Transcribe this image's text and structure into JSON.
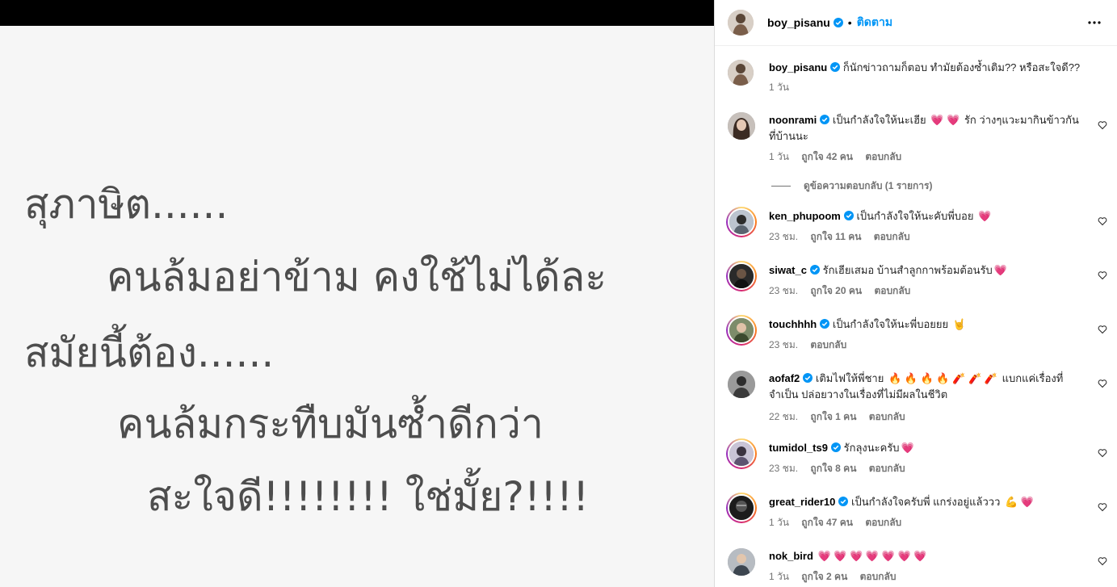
{
  "media": {
    "lines": [
      "สุภาษิต......",
      "คนล้มอย่าข้าม คงใช้ไม่ได้ละ",
      "สมัยนี้ต้อง......",
      "คนล้มกระทืบมันซ้ำดีกว่า",
      "สะใจดี!!!!!!!! ใช่มั้ย?!!!!"
    ]
  },
  "header": {
    "username": "boy_pisanu",
    "dot": "•",
    "follow_label": "ติดตาม"
  },
  "caption": {
    "username": "boy_pisanu",
    "text": "ก็นักข่าวถามก็ตอบ ทำมัยต้องซ้ำเติม?? หรือสะใจดี??",
    "time": "1 วัน"
  },
  "comments": [
    {
      "username": "noonrami",
      "text_a": "เป็นกำลังใจให้นะเฮีย",
      "emoji_a": "💗 💗",
      "text_b": "รัก ว่างๆแวะมากินข้าวกันที่บ้านนะ",
      "time": "1 วัน",
      "likes": "ถูกใจ 42 คน",
      "reply": "ตอบกลับ"
    },
    {
      "username": "ken_phupoom",
      "text_a": "เป็นกำลังใจให้นะคับพี่บอย",
      "emoji_a": "💗",
      "time": "23 ชม.",
      "likes": "ถูกใจ 11 คน",
      "reply": "ตอบกลับ"
    },
    {
      "username": "siwat_c",
      "text_a": "รักเฮียเสมอ บ้านสำลูกกาพร้อมต้อนรับ",
      "emoji_a": "💗",
      "time": "23 ชม.",
      "likes": "ถูกใจ 20 คน",
      "reply": "ตอบกลับ"
    },
    {
      "username": "touchhhh",
      "text_a": "เป็นกำลังใจให้นะพี่บอยยย",
      "emoji_a": "🤘",
      "time": "23 ชม.",
      "reply": "ตอบกลับ"
    },
    {
      "username": "aofaf2",
      "text_a": "เติมไฟให้พี่ชาย",
      "emoji_a": "🔥 🔥 🔥 🔥 🧨 🧨 🧨",
      "text_b": "แบกแค่เรื่องที่จำเป็น ปล่อยวางในเรื่องที่ไม่มีผลในชีวิต",
      "time": "22 ชม.",
      "likes": "ถูกใจ 1 คน",
      "reply": "ตอบกลับ"
    },
    {
      "username": "tumidol_ts9",
      "text_a": "รักลุงนะครับ",
      "emoji_a": "💗",
      "time": "23 ชม.",
      "likes": "ถูกใจ 8 คน",
      "reply": "ตอบกลับ"
    },
    {
      "username": "great_rider10",
      "text_a": "เป็นกำลังใจครับพี่ แกร่งอยู่แล้ววว",
      "emoji_a": "💪 💗",
      "time": "1 วัน",
      "likes": "ถูกใจ 47 คน",
      "reply": "ตอบกลับ"
    },
    {
      "username": "nok_bird",
      "emoji_a": "💗 💗 💗 💗 💗 💗 💗",
      "time": "1 วัน",
      "likes": "ถูกใจ 2 คน",
      "reply": "ตอบกลับ"
    }
  ],
  "view_replies": "ดูข้อความตอบกลับ (1 รายการ)",
  "colors": {
    "verified": "#0095f6",
    "follow": "#0095f6",
    "meta": "#737373"
  }
}
